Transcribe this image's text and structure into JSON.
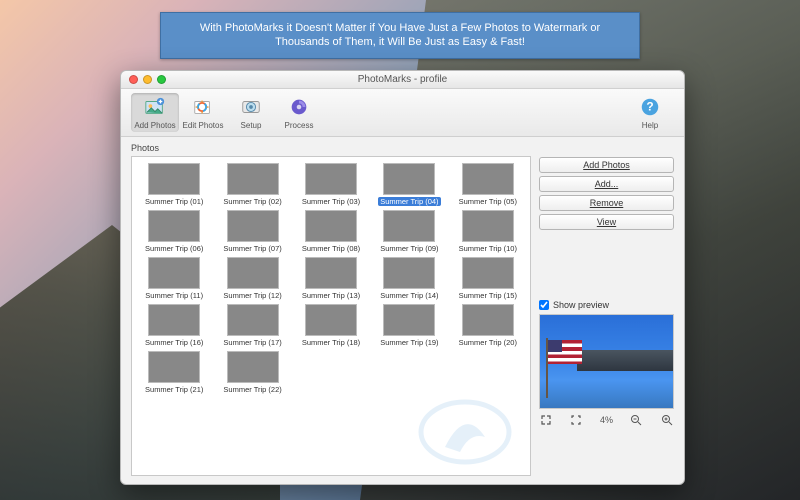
{
  "banner": "With PhotoMarks it Doesn't Matter if You Have Just a Few Photos to Watermark or Thousands of Them, it Will Be Just as Easy & Fast!",
  "window": {
    "title": "PhotoMarks - profile"
  },
  "toolbar": {
    "add_photos": "Add Photos",
    "edit_photos": "Edit Photos",
    "setup": "Setup",
    "process": "Process",
    "help": "Help"
  },
  "sections": {
    "photos": "Photos"
  },
  "sidebar": {
    "add_photos": "Add Photos",
    "add_more": "Add...",
    "remove": "Remove",
    "view": "View",
    "show_preview": "Show preview",
    "zoom_level": "4%"
  },
  "photos": [
    {
      "label": "Summer Trip (01)",
      "tone": "t-night"
    },
    {
      "label": "Summer Trip (02)",
      "tone": "t-city"
    },
    {
      "label": "Summer Trip (03)",
      "tone": "t-sky"
    },
    {
      "label": "Summer Trip (04)",
      "tone": "t-dusk",
      "selected": true
    },
    {
      "label": "Summer Trip (05)",
      "tone": "t-blue"
    },
    {
      "label": "Summer Trip (06)",
      "tone": "t-city"
    },
    {
      "label": "Summer Trip (07)",
      "tone": "t-dusk"
    },
    {
      "label": "Summer Trip (08)",
      "tone": "t-night"
    },
    {
      "label": "Summer Trip (09)",
      "tone": "t-green"
    },
    {
      "label": "Summer Trip (10)",
      "tone": "t-night"
    },
    {
      "label": "Summer Trip (11)",
      "tone": "t-sky"
    },
    {
      "label": "Summer Trip (12)",
      "tone": "t-city"
    },
    {
      "label": "Summer Trip (13)",
      "tone": "t-sky"
    },
    {
      "label": "Summer Trip (14)",
      "tone": "t-sky"
    },
    {
      "label": "Summer Trip (15)",
      "tone": "t-blue"
    },
    {
      "label": "Summer Trip (16)",
      "tone": "t-dusk"
    },
    {
      "label": "Summer Trip (17)",
      "tone": "t-blue"
    },
    {
      "label": "Summer Trip (18)",
      "tone": "t-city"
    },
    {
      "label": "Summer Trip (19)",
      "tone": "t-green"
    },
    {
      "label": "Summer Trip (20)",
      "tone": "t-sky"
    },
    {
      "label": "Summer Trip (21)",
      "tone": "t-sky"
    },
    {
      "label": "Summer Trip (22)",
      "tone": "t-sky"
    }
  ]
}
